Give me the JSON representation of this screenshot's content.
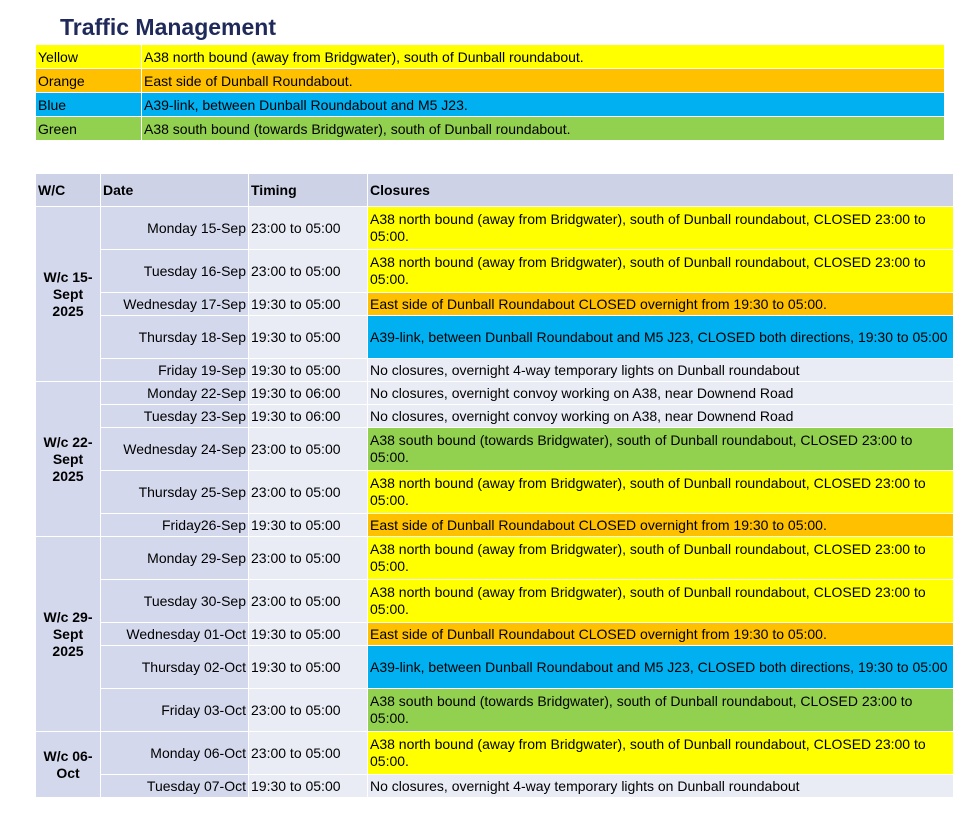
{
  "title": "Traffic Management",
  "colors": {
    "yellow": "#ffff00",
    "orange": "#ffc000",
    "blue": "#00b0f0",
    "green": "#92d050"
  },
  "legend": [
    {
      "color": "Yellow",
      "desc": "A38 north bound (away from Bridgwater), south of Dunball roundabout."
    },
    {
      "color": "Orange",
      "desc": "East side of Dunball Roundabout."
    },
    {
      "color": "Blue",
      "desc": "A39-link, between Dunball Roundabout and M5 J23."
    },
    {
      "color": "Green",
      "desc": "A38 south bound (towards Bridgwater), south of Dunball roundabout."
    }
  ],
  "headers": {
    "wc": "W/C",
    "date": "Date",
    "timing": "Timing",
    "closures": "Closures"
  },
  "weeks": [
    {
      "label": "W/c  15-\nSept\n2025",
      "rows": [
        {
          "date": "Monday 15-Sep",
          "timing": "23:00 to 05:00",
          "closure": "A38 north bound (away from Bridgwater), south of Dunball roundabout, CLOSED 23:00 to 05:00.",
          "color": "yellow"
        },
        {
          "date": "Tuesday 16-Sep",
          "timing": "23:00 to 05:00",
          "closure": "A38 north bound (away from Bridgwater), south of Dunball roundabout, CLOSED 23:00 to 05:00.",
          "color": "yellow"
        },
        {
          "date": "Wednesday 17-Sep",
          "timing": "19:30 to 05:00",
          "closure": "East side of Dunball Roundabout CLOSED overnight from 19:30 to 05:00.",
          "color": "orange"
        },
        {
          "date": "Thursday 18-Sep",
          "timing": "19:30 to 05:00",
          "closure": "A39-link, between Dunball Roundabout and M5 J23, CLOSED both directions, 19:30 to 05:00",
          "color": "blue"
        },
        {
          "date": "Friday 19-Sep",
          "timing": "19:30 to 05:00",
          "closure": "No closures, overnight 4-way temporary lights on Dunball roundabout",
          "color": ""
        }
      ]
    },
    {
      "label": "W/c 22-\nSept\n2025",
      "rows": [
        {
          "date": "Monday 22-Sep",
          "timing": "19:30 to 06:00",
          "closure": "No closures, overnight convoy working on A38, near Downend Road",
          "color": ""
        },
        {
          "date": "Tuesday 23-Sep",
          "timing": "19:30 to 06:00",
          "closure": "No closures, overnight convoy working on A38, near Downend Road",
          "color": ""
        },
        {
          "date": "Wednesday 24-Sep",
          "timing": "23:00 to 05:00",
          "closure": "A38 south bound (towards Bridgwater), south of Dunball roundabout, CLOSED 23:00 to 05:00.",
          "color": "green"
        },
        {
          "date": "Thursday 25-Sep",
          "timing": "23:00 to 05:00",
          "closure": "A38 north bound (away from Bridgwater), south of Dunball roundabout, CLOSED 23:00 to 05:00.",
          "color": "yellow"
        },
        {
          "date": "Friday26-Sep",
          "timing": "19:30 to 05:00",
          "closure": "East side of Dunball Roundabout CLOSED overnight from 19:30 to 05:00.",
          "color": "orange"
        }
      ]
    },
    {
      "label": "W/c 29-\nSept\n2025",
      "rows": [
        {
          "date": "Monday 29-Sep",
          "timing": "23:00 to 05:00",
          "closure": "A38 north bound (away from Bridgwater), south of Dunball roundabout, CLOSED 23:00 to 05:00.",
          "color": "yellow"
        },
        {
          "date": "Tuesday 30-Sep",
          "timing": "23:00 to 05:00",
          "closure": "A38 north bound (away from Bridgwater), south of Dunball roundabout, CLOSED 23:00 to 05:00.",
          "color": "yellow"
        },
        {
          "date": "Wednesday 01-Oct",
          "timing": "19:30 to 05:00",
          "closure": "East side of Dunball Roundabout CLOSED overnight from 19:30 to 05:00.",
          "color": "orange"
        },
        {
          "date": "Thursday 02-Oct",
          "timing": "19:30 to 05:00",
          "closure": "A39-link, between Dunball Roundabout and M5 J23, CLOSED both directions, 19:30 to 05:00",
          "color": "blue"
        },
        {
          "date": "Friday 03-Oct",
          "timing": "23:00 to 05:00",
          "closure": "A38 south bound (towards Bridgwater), south of Dunball roundabout, CLOSED 23:00 to 05:00.",
          "color": "green"
        }
      ]
    },
    {
      "label": "W/c 06-\nOct",
      "rows": [
        {
          "date": "Monday 06-Oct",
          "timing": "23:00 to 05:00",
          "closure": "A38 north bound (away from Bridgwater), south of Dunball roundabout, CLOSED 23:00 to 05:00.",
          "color": "yellow"
        },
        {
          "date": "Tuesday 07-Oct",
          "timing": "19:30 to 05:00",
          "closure": "No closures, overnight 4-way temporary lights on Dunball roundabout",
          "color": ""
        }
      ]
    }
  ]
}
